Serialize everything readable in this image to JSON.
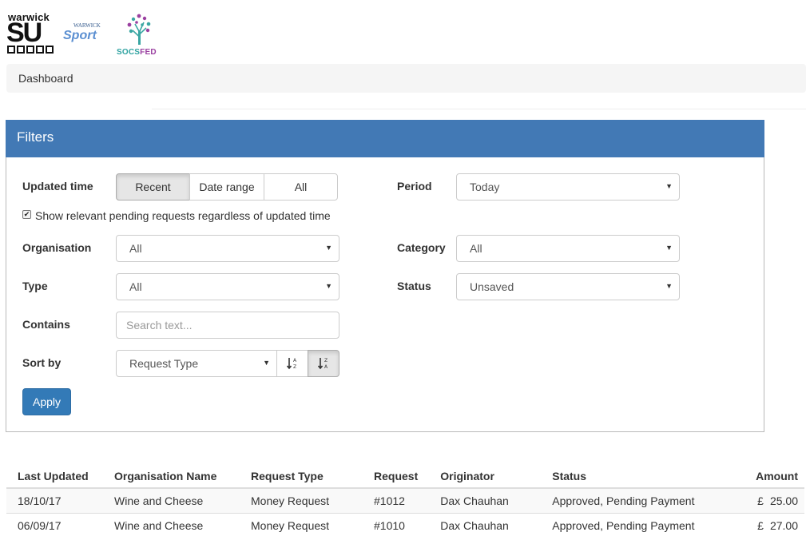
{
  "logos": {
    "su_word": "warwick",
    "su_big": "SU",
    "sport_small": "WARWICK",
    "sport_big": "Sport",
    "socs_a": "SOCS",
    "socs_b": "FED"
  },
  "breadcrumb": {
    "label": "Dashboard"
  },
  "filters": {
    "title": "Filters",
    "updated_time": {
      "label": "Updated time",
      "options": [
        "Recent",
        "Date range",
        "All"
      ],
      "selected": "Recent"
    },
    "show_pending": {
      "label": "Show relevant pending requests regardless of updated time",
      "checked": true
    },
    "period": {
      "label": "Period",
      "value": "Today"
    },
    "organisation": {
      "label": "Organisation",
      "value": "All"
    },
    "category": {
      "label": "Category",
      "value": "All"
    },
    "type": {
      "label": "Type",
      "value": "All"
    },
    "status": {
      "label": "Status",
      "value": "Unsaved"
    },
    "contains": {
      "label": "Contains",
      "placeholder": "Search text...",
      "value": ""
    },
    "sort_by": {
      "label": "Sort by",
      "value": "Request Type",
      "direction": "descending"
    },
    "apply_label": "Apply"
  },
  "table": {
    "headers": [
      "Last Updated",
      "Organisation Name",
      "Request Type",
      "Request",
      "Originator",
      "Status",
      "Amount"
    ],
    "rows": [
      {
        "updated": "18/10/17",
        "org": "Wine and Cheese",
        "type": "Money Request",
        "request": "#1012",
        "originator": "Dax Chauhan",
        "status": "Approved, Pending Payment",
        "currency": "£",
        "amount": "25.00"
      },
      {
        "updated": "06/09/17",
        "org": "Wine and Cheese",
        "type": "Money Request",
        "request": "#1010",
        "originator": "Dax Chauhan",
        "status": "Approved, Pending Payment",
        "currency": "£",
        "amount": "27.00"
      }
    ]
  },
  "colors": {
    "panel_heading": "#4279b5",
    "primary_button": "#337ab7"
  }
}
